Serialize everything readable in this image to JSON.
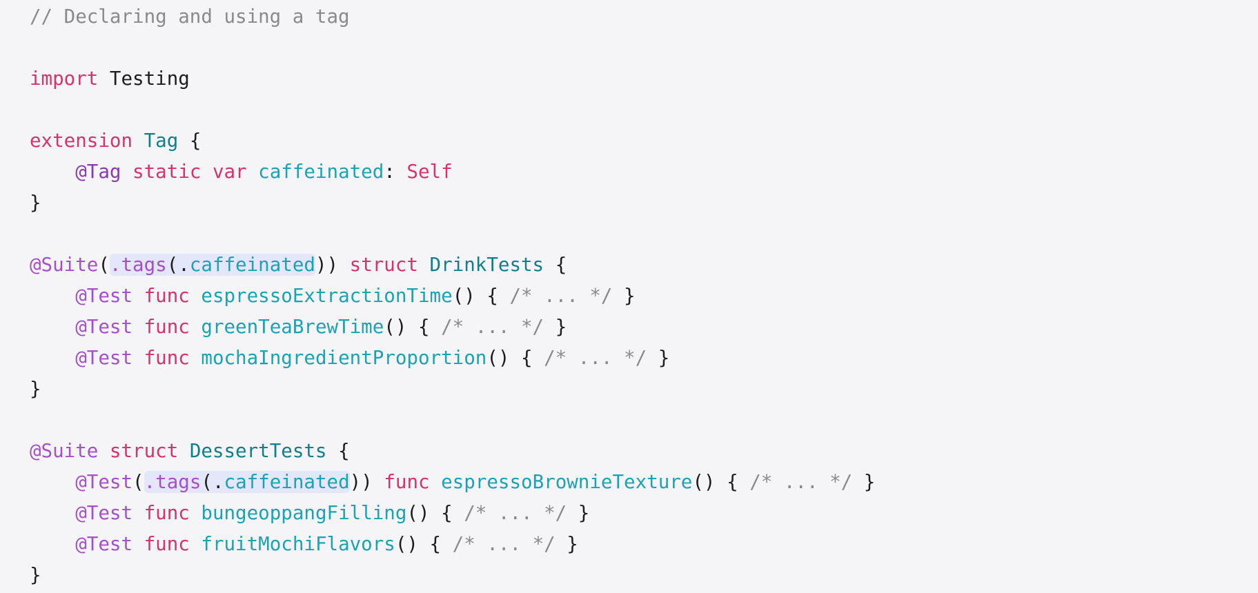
{
  "code": {
    "comment_line": "// Declaring and using a tag",
    "import_kw": "import",
    "import_module": "Testing",
    "extension_kw": "extension",
    "tag_type": "Tag",
    "open_brace": "{",
    "close_brace": "}",
    "tag_attr": "@Tag",
    "static_kw": "static",
    "var_kw": "var",
    "caffeinated_name": "caffeinated",
    "colon": ":",
    "self_type": "Self",
    "suite_attr": "@Suite",
    "test_attr": "@Test",
    "struct_kw": "struct",
    "func_kw": "func",
    "tags_call": {
      "open_paren": "(",
      "dot_tags": ".tags",
      "inner_open": "(",
      "dot_caffeinated_dot": ".",
      "caffeinated": "caffeinated",
      "inner_close": ")",
      "close_paren": ")"
    },
    "drink_suite": {
      "name": "DrinkTests",
      "funcs": [
        {
          "name": "espressoExtractionTime",
          "body": "{ /* ... */ }"
        },
        {
          "name": "greenTeaBrewTime",
          "body": "{ /* ... */ }"
        },
        {
          "name": "mochaIngredientProportion",
          "body": "{ /* ... */ }"
        }
      ]
    },
    "dessert_suite": {
      "name": "DessertTests",
      "funcs": [
        {
          "name": "espressoBrownieTexture",
          "body": "{ /* ... */ }"
        },
        {
          "name": "bungeoppangFilling",
          "body": "{ /* ... */ }"
        },
        {
          "name": "fruitMochiFlavors",
          "body": "{ /* ... */ }"
        }
      ]
    },
    "call_parens": "()",
    "body_open": "{",
    "body_comment": "/* ... */",
    "body_close": "}"
  },
  "colors": {
    "background": "#f5f5f7",
    "comment": "#8a8a8e",
    "keyword": "#d6336c",
    "attribute": "#a550c9",
    "type": "#0f7f8d",
    "identifier": "#1aa3b5",
    "highlight": "#e3e7f9"
  }
}
